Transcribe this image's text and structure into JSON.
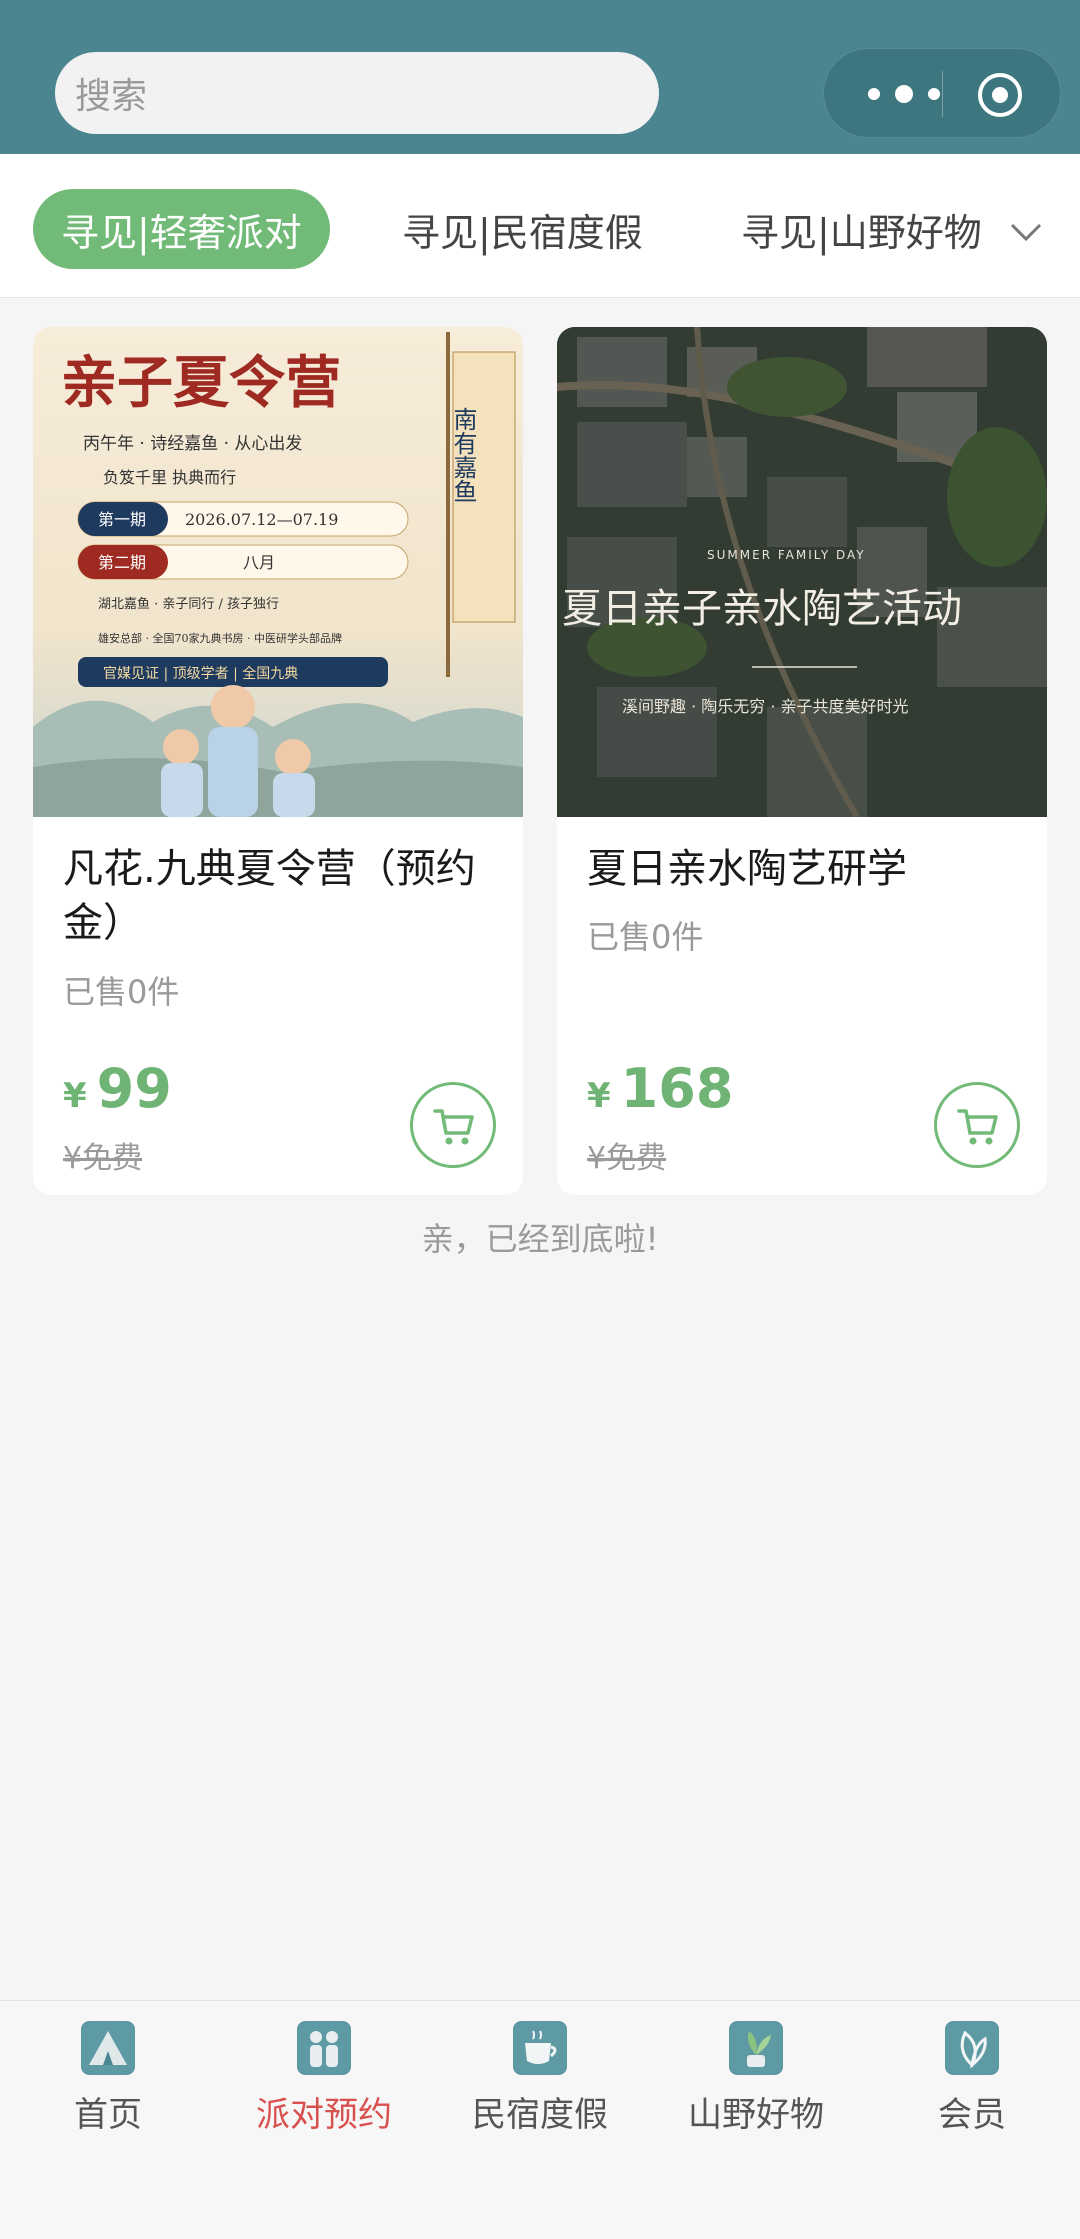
{
  "search": {
    "placeholder": "搜索"
  },
  "category_tabs": [
    {
      "label": "寻见|轻奢派对",
      "active": true
    },
    {
      "label": "寻见|民宿度假",
      "active": false
    },
    {
      "label": "寻见|山野好物",
      "active": false
    }
  ],
  "products": [
    {
      "title": "凡花.九典夏令营（预约金）",
      "sold": "已售0件",
      "price_symbol": "¥",
      "price": "99",
      "original_price": "¥免费",
      "image": {
        "heading": "亲子夏令营",
        "line1": "丙午年 · 诗经嘉鱼 · 从心出发",
        "line2": "负笈千里   执典而行",
        "period1_label": "第一期",
        "period1_value": "2026.07.12—07.19",
        "period2_label": "第二期",
        "period2_value": "八月",
        "info1": "湖北嘉鱼 · 亲子同行 / 孩子独行",
        "info2": "雄安总部 · 全国70家九典书房 · 中医研学头部品牌",
        "banner": "官媒见证 | 顶级学者 | 全国九典",
        "flag": "南有嘉鱼"
      }
    },
    {
      "title": "夏日亲水陶艺研学",
      "sold": "已售0件",
      "price_symbol": "¥",
      "price": "168",
      "original_price": "¥免费",
      "image": {
        "overlay_small": "SUMMER FAMILY DAY",
        "overlay_title": "夏日亲子亲水陶艺活动",
        "overlay_sub": "溪间野趣 · 陶乐无穷 · 亲子共度美好时光"
      }
    }
  ],
  "end_message": "亲，已经到底啦!",
  "tabbar": [
    {
      "label": "首页",
      "icon": "tent-icon",
      "active": false
    },
    {
      "label": "派对预约",
      "icon": "family-icon",
      "active": true
    },
    {
      "label": "民宿度假",
      "icon": "tea-cup-icon",
      "active": false
    },
    {
      "label": "山野好物",
      "icon": "plant-icon",
      "active": false
    },
    {
      "label": "会员",
      "icon": "leaf-icon",
      "active": false
    }
  ],
  "colors": {
    "header": "#4a8590",
    "accent_green": "#72ba77",
    "active_tab_text": "#d9514e"
  }
}
